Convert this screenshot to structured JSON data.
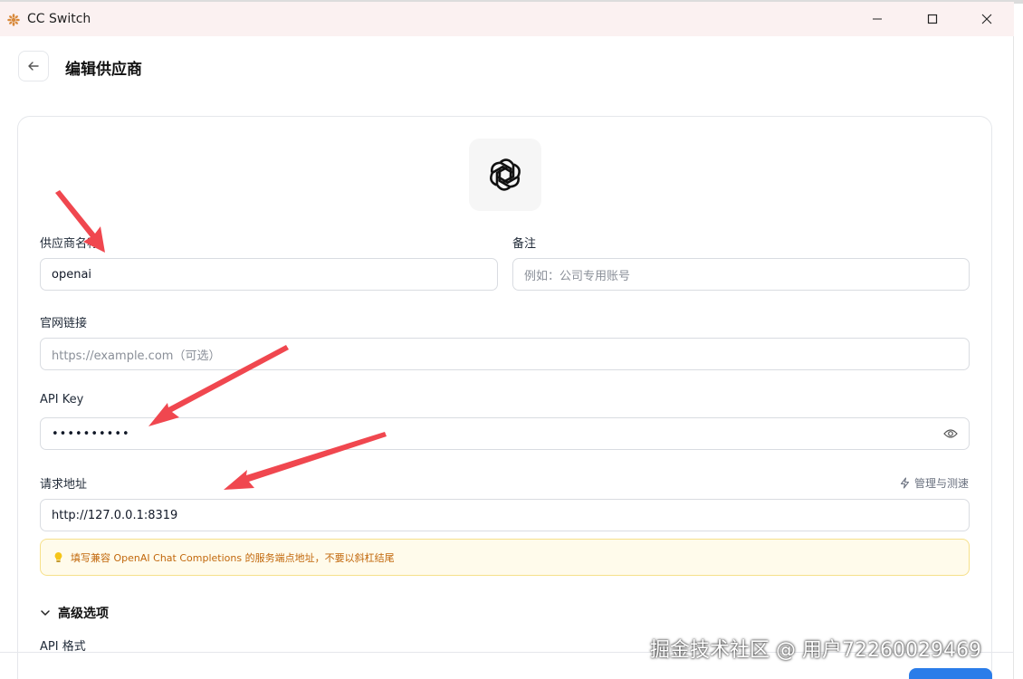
{
  "window": {
    "title": "CC Switch"
  },
  "header": {
    "title": "编辑供应商"
  },
  "form": {
    "provider_name": {
      "label": "供应商名称",
      "value": "openai"
    },
    "notes": {
      "label": "备注",
      "placeholder": "例如：公司专用账号"
    },
    "website": {
      "label": "官网链接",
      "placeholder": "https://example.com（可选）"
    },
    "api_key": {
      "label": "API Key",
      "masked_value": "••••••••••"
    },
    "endpoint": {
      "label": "请求地址",
      "value": "http://127.0.0.1:8319",
      "manage_label": "管理与测速",
      "hint": "填写兼容 OpenAI Chat Completions 的服务端点地址，不要以斜杠结尾"
    },
    "advanced": {
      "label": "高级选项",
      "api_format_label": "API 格式"
    }
  },
  "watermark": "掘金技术社区 @ 用户72260029469",
  "colors": {
    "titlebar_bg": "#fbf1f1",
    "hint_bg": "#fffbeb",
    "hint_text": "#c2680c",
    "arrow": "#f0474f",
    "primary": "#2b7de9"
  }
}
